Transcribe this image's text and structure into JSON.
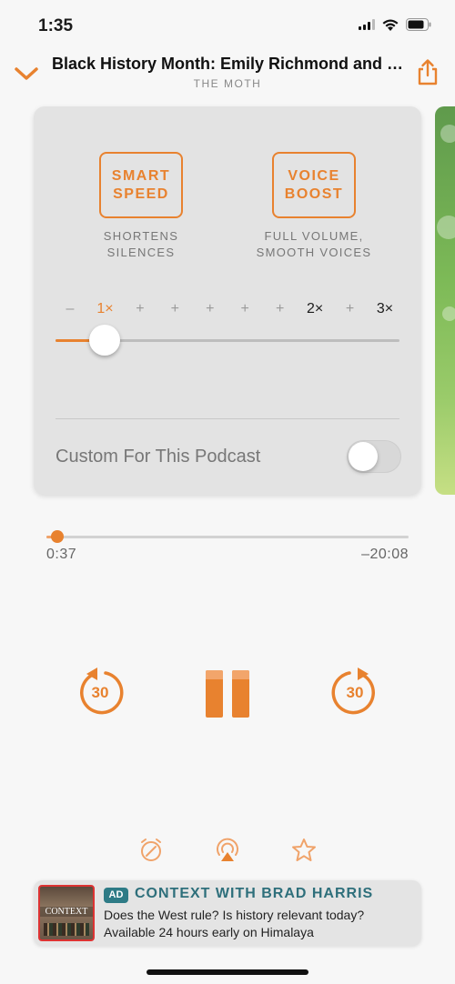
{
  "status_bar": {
    "time": "1:35",
    "icons": [
      "cellular-signal-icon",
      "wifi-icon",
      "battery-icon"
    ]
  },
  "header": {
    "episode_title": "Black History Month: Emily Richmond and Ma…",
    "podcast_name": "THE MOTH",
    "collapse_icon": "chevron-down-icon",
    "share_icon": "share-icon"
  },
  "effects": {
    "smart_speed": {
      "line1": "SMART",
      "line2": "SPEED",
      "desc1": "SHORTENS",
      "desc2": "SILENCES"
    },
    "voice_boost": {
      "line1": "VOICE",
      "line2": "BOOST",
      "desc1": "FULL VOLUME,",
      "desc2": "SMOOTH VOICES"
    },
    "speed_ticks": [
      "–",
      "1×",
      "+",
      "+",
      "+",
      "+",
      "+",
      "2×",
      "+",
      "3×"
    ],
    "active_tick_index": 1,
    "current_speed": 1,
    "custom_label": "Custom For This Podcast",
    "custom_enabled": false
  },
  "playback": {
    "progress_fraction": 0.03,
    "elapsed": "0:37",
    "remaining": "–20:08",
    "skip_back_seconds": "30",
    "skip_forward_seconds": "30",
    "state": "playing"
  },
  "bottom_actions": [
    "sleep-timer-icon",
    "airplay-icon",
    "star-icon"
  ],
  "ad": {
    "badge": "AD",
    "title": "CONTEXT WITH BRAD HARRIS",
    "line1": "Does the West rule? Is history relevant today?",
    "line2": "Available 24 hours early on Himalaya",
    "artwork_text": "CONTEXT"
  },
  "colors": {
    "accent": "#e8822f",
    "ad_accent": "#2e6f7b",
    "background": "#f7f7f7",
    "panel": "#e3e3e3"
  }
}
